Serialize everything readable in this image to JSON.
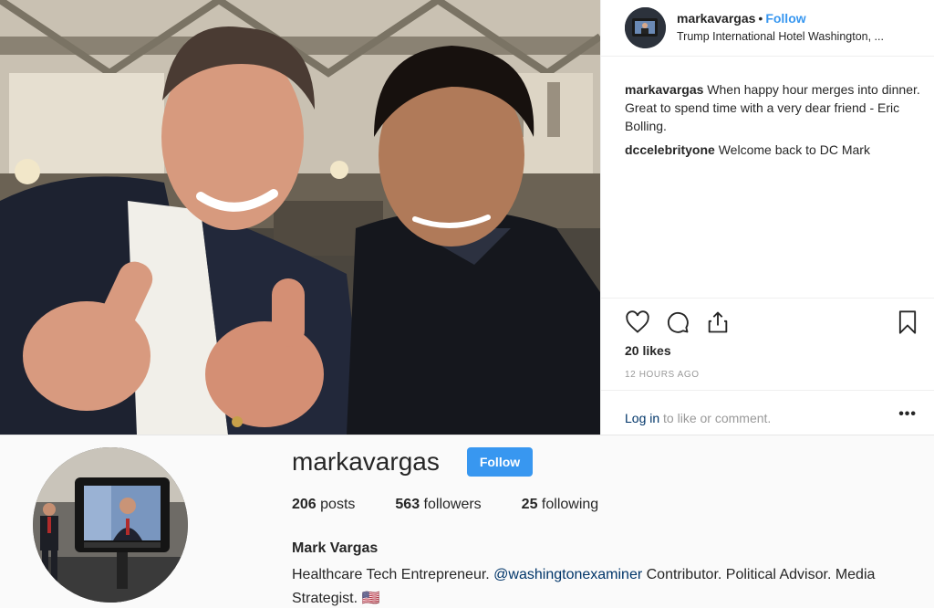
{
  "post": {
    "header": {
      "username": "markavargas",
      "separator": "•",
      "follow_label": "Follow",
      "location": "Trump International Hotel Washington, ..."
    },
    "comments": [
      {
        "user": "markavargas",
        "text": "When happy hour merges into dinner. Great to spend time with a very dear friend - Eric Bolling."
      },
      {
        "user": "dccelebrityone",
        "text": "Welcome back to DC Mark"
      }
    ],
    "icons": [
      "heart-icon",
      "comment-icon",
      "share-icon",
      "bookmark-icon"
    ],
    "likes": "20 likes",
    "timestamp": "12 HOURS AGO",
    "login_link": "Log in",
    "login_rest": " to like or comment.",
    "more": "•••"
  },
  "profile": {
    "username": "markavargas",
    "follow_label": "Follow",
    "stats": [
      {
        "count": "206",
        "label": " posts"
      },
      {
        "count": "563",
        "label": " followers"
      },
      {
        "count": "25",
        "label": " following"
      }
    ],
    "full_name": "Mark Vargas",
    "bio_part1": "Healthcare Tech Entrepreneur. ",
    "bio_mention": "@washingtonexaminer",
    "bio_part2": " Contributor. Political Advisor. Media Strategist. ",
    "bio_flag": "🇺🇸"
  },
  "colors": {
    "accent": "#3897f0",
    "link": "#003569",
    "text": "#262626",
    "muted": "#999999"
  }
}
